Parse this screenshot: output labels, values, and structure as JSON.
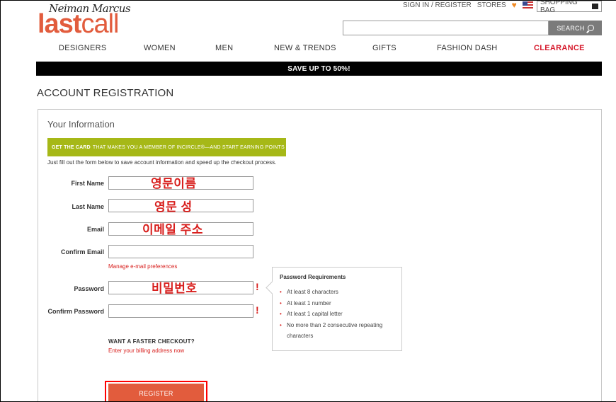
{
  "header": {
    "logo_top": "Neiman Marcus",
    "logo_bold": "last",
    "logo_light": "call",
    "sign_in": "SIGN IN / REGISTER",
    "stores": "STORES",
    "shopping_bag": "SHOPPING BAG",
    "search_placeholder": "",
    "search_button": "SEARCH"
  },
  "nav": {
    "items": [
      "DESIGNERS",
      "WOMEN",
      "MEN",
      "NEW & TRENDS",
      "GIFTS",
      "FASHION DASH",
      "CLEARANCE"
    ]
  },
  "promo": "SAVE UP TO 50%!",
  "page_title": "ACCOUNT REGISTRATION",
  "form": {
    "section_title": "Your Information",
    "card_banner_bold": "GET THE CARD",
    "card_banner_text": "THAT MAKES YOU A MEMBER OF INCIRCLE®—AND START EARNING POINTS ▸",
    "intro": "Just fill out the form below to save account information and speed up the checkout process.",
    "fields": {
      "first_name": {
        "label": "First Name",
        "annotation": "영문이름"
      },
      "last_name": {
        "label": "Last Name",
        "annotation": "영문 성"
      },
      "email": {
        "label": "Email",
        "annotation": "이메일 주소"
      },
      "confirm_email": {
        "label": "Confirm Email"
      },
      "password": {
        "label": "Password",
        "annotation": "비밀번호"
      },
      "confirm_password": {
        "label": "Confirm Password"
      }
    },
    "manage_email_link": "Manage e-mail preferences",
    "error_mark": "!",
    "password_requirements": {
      "title": "Password Requirements",
      "items": [
        "At least 8 characters",
        "At least 1 number",
        "At least 1 capital letter",
        "No more than 2 consecutive repeating characters"
      ]
    },
    "faster_checkout": "WANT A FASTER CHECKOUT?",
    "billing_link": "Enter your billing address now",
    "register_button": "REGISTER"
  },
  "colors": {
    "brand_orange": "#e25c3d",
    "clearance_red": "#d61a2c",
    "card_green": "#a6b817",
    "highlight_red": "#ff0000"
  }
}
